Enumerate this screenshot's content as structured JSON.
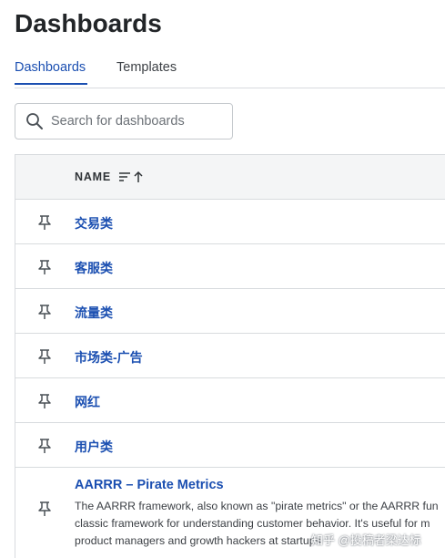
{
  "page": {
    "title": "Dashboards"
  },
  "tabs": [
    {
      "label": "Dashboards",
      "active": true
    },
    {
      "label": "Templates",
      "active": false
    }
  ],
  "search": {
    "placeholder": "Search for dashboards",
    "value": ""
  },
  "table": {
    "name_header": "NAME",
    "sort": "ascending",
    "rows": [
      {
        "name": "交易类",
        "icon": "pin-icon"
      },
      {
        "name": "客服类",
        "icon": "pin-icon"
      },
      {
        "name": "流量类",
        "icon": "pin-icon"
      },
      {
        "name": "市场类-广告",
        "icon": "pin-icon"
      },
      {
        "name": "网红",
        "icon": "pin-icon"
      },
      {
        "name": "用户类",
        "icon": "pin-icon"
      }
    ],
    "template_row": {
      "name": "AARRR – Pirate Metrics",
      "icon": "pin-icon",
      "description_lines": [
        "The AARRR framework, also known as \"pirate metrics\" or the AARRR fun",
        "classic framework for understanding customer behavior. It's useful for m",
        "product managers and growth hackers at startups"
      ]
    }
  },
  "watermark": "知乎 @投稿者梁达标",
  "colors": {
    "accent": "#1b4fb1",
    "border": "#d8dbde",
    "header_bg": "#f4f5f6"
  }
}
